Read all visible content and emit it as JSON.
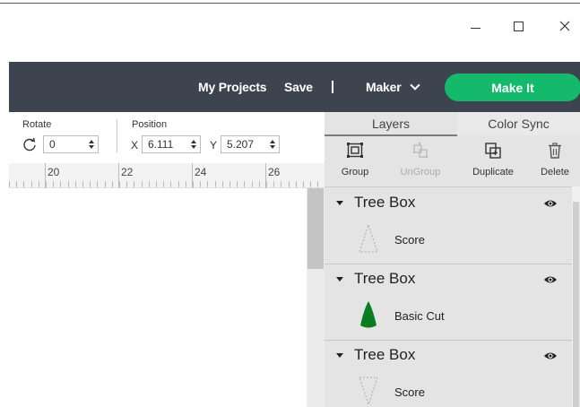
{
  "window": {
    "minimize_glyph": "–",
    "maximize_glyph": "□",
    "close_glyph": "✕"
  },
  "header": {
    "my_projects": "My Projects",
    "save": "Save",
    "machine": "Maker",
    "make_it": "Make It",
    "colors": {
      "bar": "#3d4450",
      "make_it": "#14b96c"
    }
  },
  "toolbar": {
    "rotate": {
      "label": "Rotate",
      "value": "0"
    },
    "position": {
      "label": "Position",
      "x_label": "X",
      "x_value": "6.111",
      "y_label": "Y",
      "y_value": "5.207"
    }
  },
  "ruler": {
    "labels": [
      "20",
      "22",
      "24",
      "26"
    ]
  },
  "panel": {
    "tabs": [
      {
        "label": "Layers",
        "active": true
      },
      {
        "label": "Color Sync",
        "active": false
      }
    ],
    "tools": [
      {
        "label": "Group",
        "icon": "group-icon",
        "enabled": true
      },
      {
        "label": "UnGroup",
        "icon": "ungroup-icon",
        "enabled": false
      },
      {
        "label": "Duplicate",
        "icon": "duplicate-icon",
        "enabled": true
      },
      {
        "label": "Delete",
        "icon": "trash-icon",
        "enabled": true
      }
    ],
    "layer_groups": [
      {
        "title": "Tree Box",
        "layer": {
          "label": "Score",
          "kind": "score"
        }
      },
      {
        "title": "Tree Box",
        "layer": {
          "label": "Basic Cut",
          "kind": "cut",
          "color": "#0a7d22"
        }
      },
      {
        "title": "Tree Box",
        "layer": {
          "label": "Score",
          "kind": "score"
        }
      }
    ]
  }
}
